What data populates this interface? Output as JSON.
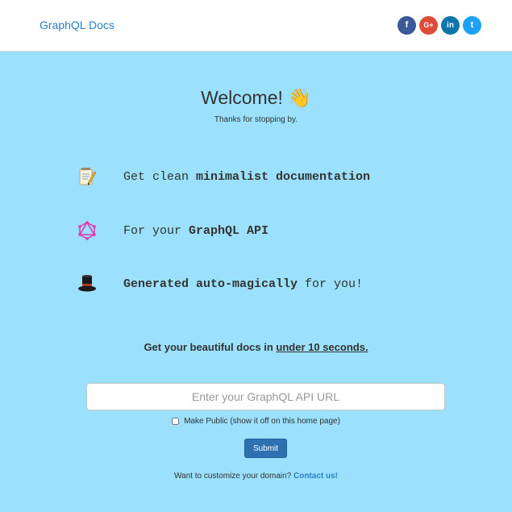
{
  "header": {
    "brand": "GraphQL Docs",
    "social": [
      {
        "icon": "facebook-icon",
        "glyph": "f",
        "color": "#3b5998"
      },
      {
        "icon": "google-plus-icon",
        "glyph": "G+",
        "color": "#dd4b39"
      },
      {
        "icon": "linkedin-icon",
        "glyph": "in",
        "color": "#0e76a8"
      },
      {
        "icon": "twitter-icon",
        "glyph": "t",
        "color": "#1da1f2"
      }
    ]
  },
  "hero": {
    "welcome": "Welcome!",
    "welcome_emoji": "👋",
    "tagline": "Thanks for stopping by."
  },
  "features": [
    {
      "icon": "notepad-icon",
      "pre": "Get clean ",
      "bold": "minimalist documentation",
      "post": ""
    },
    {
      "icon": "graphql-logo-icon",
      "pre": "For your ",
      "bold": "GraphQL API",
      "post": ""
    },
    {
      "icon": "top-hat-icon",
      "pre": "",
      "bold": "Generated auto-magically",
      "post": " for you!"
    }
  ],
  "promo": {
    "text": "Get your beautiful docs in ",
    "underlined": "under 10 seconds."
  },
  "form": {
    "url_placeholder": "Enter your GraphQL API URL",
    "url_value": "",
    "public_label": "Make Public (show it off on this home page)",
    "public_checked": false,
    "submit_label": "Submit"
  },
  "footer": {
    "text": "Want to customize your domain? ",
    "link": "Contact us!"
  },
  "colors": {
    "background": "#9be0fc",
    "header_bg": "#ffffff",
    "accent": "#2a7fc8",
    "button": "#2d71b3"
  }
}
